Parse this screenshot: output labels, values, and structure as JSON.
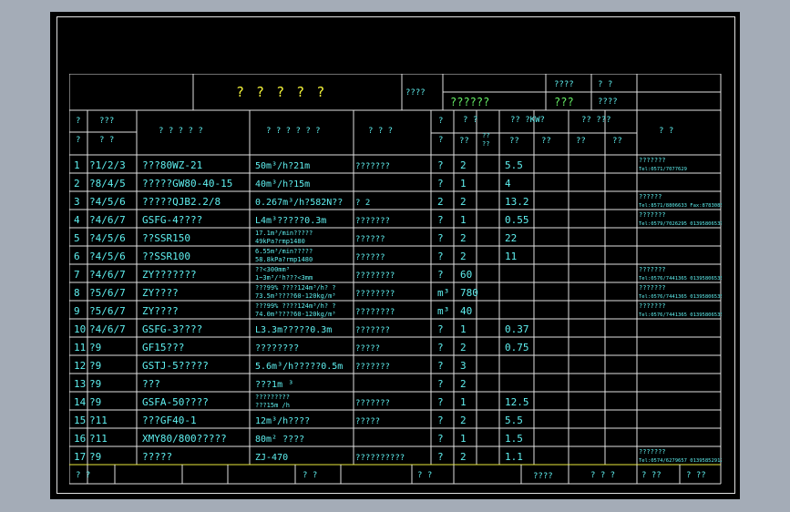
{
  "title": {
    "main": "? ? ? ? ?",
    "label1": "????",
    "cell_a": "????",
    "cell_b": "?  ?",
    "cell_c": "??????",
    "cell_d": "???",
    "cell_e": "????"
  },
  "headers": {
    "c0a": "?",
    "c0b": "?",
    "c1a": "???",
    "c1b": "? ?",
    "c2": "? ? ? ? ?",
    "c3": "? ? ? ? ? ?",
    "c4": "? ? ?",
    "c5a": "?",
    "c5b": "?",
    "c6a": "?  ?",
    "c6b1": "??",
    "c6b2a": "??",
    "c6b2b": "??",
    "c7a": "??  ?KW?",
    "c7b1": "??",
    "c7b2": "??",
    "c8a": "??  ???",
    "c8b1": "??",
    "c8b2": "??",
    "c9": "?     ?"
  },
  "rows": [
    {
      "no": "1",
      "pos": "?1/2/3",
      "name": "???80WZ-21",
      "spec": "50m³/h?21m",
      "mat": "???????",
      "unit": "?",
      "qty": "2",
      "p1": "5.5",
      "p2": "",
      "note": "???????",
      "note2": "Tel:0571/7077629"
    },
    {
      "no": "2",
      "pos": "?8/4/5",
      "name": "?????GW80-40-15",
      "spec": "40m³/h?15m",
      "mat": "",
      "unit": "?",
      "qty": "1",
      "p1": "4",
      "p2": "",
      "note": "",
      "note2": ""
    },
    {
      "no": "3",
      "pos": "?4/5/6",
      "name": "?????QJB2.2/8",
      "spec": "0.267m³/h?582N??",
      "mat": "?   2",
      "unit": "2",
      "qty": "2",
      "p1": "13.2",
      "p2": "",
      "note": "??????",
      "note2": "Tel:8571/8806633 Fax:8783085"
    },
    {
      "no": "4",
      "pos": "?4/6/7",
      "name": "GSFG-4????",
      "spec": "L4m³?????0.3m",
      "mat": "???????",
      "unit": "?",
      "qty": "1",
      "p1": "0.55",
      "p2": "",
      "note": "???????",
      "note2": "Tel:0579/7026295 013958065393"
    },
    {
      "no": "5",
      "pos": "?4/5/6",
      "name": "??SSR150",
      "spec": "17.1m³/min?????",
      "spec2": "49kPa?rmp1480",
      "mat": "??????",
      "unit": "?",
      "qty": "2",
      "p1": "22",
      "p2": "",
      "note": "",
      "note2": ""
    },
    {
      "no": "6",
      "pos": "?4/5/6",
      "name": "??SSR100",
      "spec": "6.55m³/min?????",
      "spec2": "58.8kPa?rmp1480",
      "mat": "??????",
      "unit": "?",
      "qty": "2",
      "p1": "11",
      "p2": "",
      "note": "",
      "note2": ""
    },
    {
      "no": "7",
      "pos": "?4/6/7",
      "name": "ZY???????",
      "spec": "??<300mm³",
      "spec2": "1~3m³/²h???<3mm",
      "mat": "????????",
      "unit": "?",
      "qty": "60",
      "p1": "",
      "p2": "",
      "note": "???????",
      "note2": "Tel:0576/7441365 013958065355"
    },
    {
      "no": "8",
      "pos": "?5/6/7",
      "name": "ZY????",
      "spec": "???99%  ????124m³/h? ?",
      "spec2": "73.5m³????60-120kg/m³",
      "mat": "????????",
      "unit": "m³",
      "qty": "780",
      "p1": "",
      "p2": "",
      "note": "???????",
      "note2": "Tel:0576/7441365 013958065355"
    },
    {
      "no": "9",
      "pos": "?5/6/7",
      "name": "ZY????",
      "spec": "???99%  ????124m³/h? ?",
      "spec2": "74.0m³????60-120kg/m³",
      "mat": "????????",
      "unit": "m³",
      "qty": "40",
      "p1": "",
      "p2": "",
      "note": "???????",
      "note2": "Tel:0576/7441365 013958065355"
    },
    {
      "no": "10",
      "pos": "?4/6/7",
      "name": "GSFG-3????",
      "spec": "L3.3m?????0.3m",
      "mat": "???????",
      "unit": "?",
      "qty": "1",
      "p1": "0.37",
      "p2": "",
      "note": "",
      "note2": ""
    },
    {
      "no": "11",
      "pos": "?9",
      "name": "GF15???",
      "spec": "????????",
      "mat": "?????",
      "unit": "?",
      "qty": "2",
      "p1": "0.75",
      "p2": "",
      "note": "",
      "note2": ""
    },
    {
      "no": "12",
      "pos": "?9",
      "name": "GSTJ-5?????",
      "spec": "5.6m³/h?????0.5m",
      "mat": "???????",
      "unit": "?",
      "qty": "3",
      "p1": "",
      "p2": "",
      "note": "",
      "note2": ""
    },
    {
      "no": "13",
      "pos": "?9",
      "name": "???",
      "spec": "???1m  ³",
      "mat": "",
      "unit": "?",
      "qty": "2",
      "p1": "",
      "p2": "",
      "note": "",
      "note2": ""
    },
    {
      "no": "14",
      "pos": "?9",
      "name": "GSFA-50????",
      "spec": "?????????",
      "spec2": "???15m /h",
      "mat": "???????",
      "unit": "?",
      "qty": "1",
      "p1": "12.5",
      "p2": "",
      "note": "",
      "note2": ""
    },
    {
      "no": "15",
      "pos": "?11",
      "name": "???GF40-1",
      "spec": "12m³/h????",
      "mat": "?????",
      "unit": "?",
      "qty": "2",
      "p1": "5.5",
      "p2": "",
      "note": "",
      "note2": ""
    },
    {
      "no": "16",
      "pos": "?11",
      "name": "XMY80/800?????",
      "spec": "80m²  ????",
      "mat": "",
      "unit": "?",
      "qty": "1",
      "p1": "1.5",
      "p2": "",
      "note": "",
      "note2": ""
    },
    {
      "no": "17",
      "pos": "?9",
      "name": "?????",
      "spec": "ZJ-470",
      "mat": "??????????",
      "unit": "?",
      "qty": "2",
      "p1": "1.1",
      "p2": "",
      "note": "???????",
      "note2": "Tel:0574/6279657 013958529120"
    }
  ],
  "footer": {
    "f1": "?   ?",
    "f2": "?   ?",
    "f3": "?   ?",
    "f4": "????",
    "f5": "?   ?   ?",
    "f6": "?  ??",
    "f7": "?  ??"
  }
}
